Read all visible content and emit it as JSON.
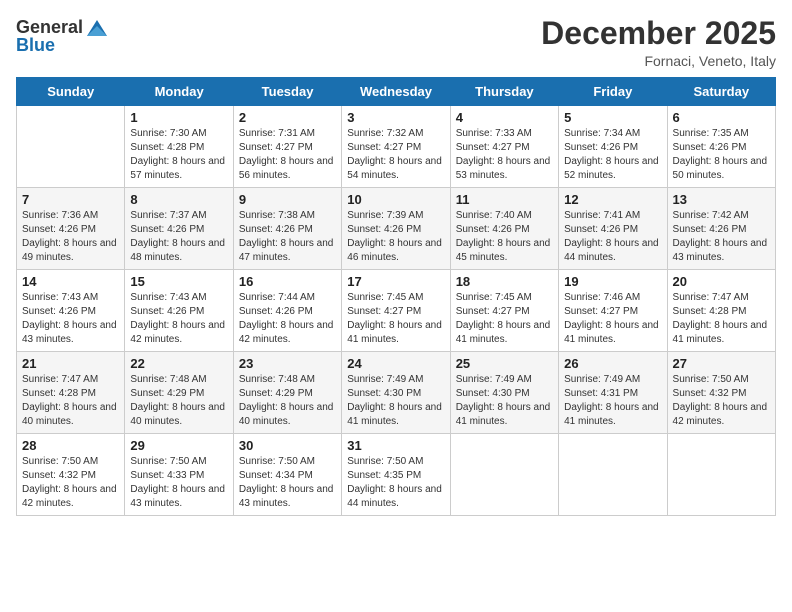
{
  "header": {
    "logo_general": "General",
    "logo_blue": "Blue",
    "month_title": "December 2025",
    "location": "Fornaci, Veneto, Italy"
  },
  "days_of_week": [
    "Sunday",
    "Monday",
    "Tuesday",
    "Wednesday",
    "Thursday",
    "Friday",
    "Saturday"
  ],
  "weeks": [
    [
      {
        "day": "",
        "sunrise": "",
        "sunset": "",
        "daylight": ""
      },
      {
        "day": "1",
        "sunrise": "Sunrise: 7:30 AM",
        "sunset": "Sunset: 4:28 PM",
        "daylight": "Daylight: 8 hours and 57 minutes."
      },
      {
        "day": "2",
        "sunrise": "Sunrise: 7:31 AM",
        "sunset": "Sunset: 4:27 PM",
        "daylight": "Daylight: 8 hours and 56 minutes."
      },
      {
        "day": "3",
        "sunrise": "Sunrise: 7:32 AM",
        "sunset": "Sunset: 4:27 PM",
        "daylight": "Daylight: 8 hours and 54 minutes."
      },
      {
        "day": "4",
        "sunrise": "Sunrise: 7:33 AM",
        "sunset": "Sunset: 4:27 PM",
        "daylight": "Daylight: 8 hours and 53 minutes."
      },
      {
        "day": "5",
        "sunrise": "Sunrise: 7:34 AM",
        "sunset": "Sunset: 4:26 PM",
        "daylight": "Daylight: 8 hours and 52 minutes."
      },
      {
        "day": "6",
        "sunrise": "Sunrise: 7:35 AM",
        "sunset": "Sunset: 4:26 PM",
        "daylight": "Daylight: 8 hours and 50 minutes."
      }
    ],
    [
      {
        "day": "7",
        "sunrise": "Sunrise: 7:36 AM",
        "sunset": "Sunset: 4:26 PM",
        "daylight": "Daylight: 8 hours and 49 minutes."
      },
      {
        "day": "8",
        "sunrise": "Sunrise: 7:37 AM",
        "sunset": "Sunset: 4:26 PM",
        "daylight": "Daylight: 8 hours and 48 minutes."
      },
      {
        "day": "9",
        "sunrise": "Sunrise: 7:38 AM",
        "sunset": "Sunset: 4:26 PM",
        "daylight": "Daylight: 8 hours and 47 minutes."
      },
      {
        "day": "10",
        "sunrise": "Sunrise: 7:39 AM",
        "sunset": "Sunset: 4:26 PM",
        "daylight": "Daylight: 8 hours and 46 minutes."
      },
      {
        "day": "11",
        "sunrise": "Sunrise: 7:40 AM",
        "sunset": "Sunset: 4:26 PM",
        "daylight": "Daylight: 8 hours and 45 minutes."
      },
      {
        "day": "12",
        "sunrise": "Sunrise: 7:41 AM",
        "sunset": "Sunset: 4:26 PM",
        "daylight": "Daylight: 8 hours and 44 minutes."
      },
      {
        "day": "13",
        "sunrise": "Sunrise: 7:42 AM",
        "sunset": "Sunset: 4:26 PM",
        "daylight": "Daylight: 8 hours and 43 minutes."
      }
    ],
    [
      {
        "day": "14",
        "sunrise": "Sunrise: 7:43 AM",
        "sunset": "Sunset: 4:26 PM",
        "daylight": "Daylight: 8 hours and 43 minutes."
      },
      {
        "day": "15",
        "sunrise": "Sunrise: 7:43 AM",
        "sunset": "Sunset: 4:26 PM",
        "daylight": "Daylight: 8 hours and 42 minutes."
      },
      {
        "day": "16",
        "sunrise": "Sunrise: 7:44 AM",
        "sunset": "Sunset: 4:26 PM",
        "daylight": "Daylight: 8 hours and 42 minutes."
      },
      {
        "day": "17",
        "sunrise": "Sunrise: 7:45 AM",
        "sunset": "Sunset: 4:27 PM",
        "daylight": "Daylight: 8 hours and 41 minutes."
      },
      {
        "day": "18",
        "sunrise": "Sunrise: 7:45 AM",
        "sunset": "Sunset: 4:27 PM",
        "daylight": "Daylight: 8 hours and 41 minutes."
      },
      {
        "day": "19",
        "sunrise": "Sunrise: 7:46 AM",
        "sunset": "Sunset: 4:27 PM",
        "daylight": "Daylight: 8 hours and 41 minutes."
      },
      {
        "day": "20",
        "sunrise": "Sunrise: 7:47 AM",
        "sunset": "Sunset: 4:28 PM",
        "daylight": "Daylight: 8 hours and 41 minutes."
      }
    ],
    [
      {
        "day": "21",
        "sunrise": "Sunrise: 7:47 AM",
        "sunset": "Sunset: 4:28 PM",
        "daylight": "Daylight: 8 hours and 40 minutes."
      },
      {
        "day": "22",
        "sunrise": "Sunrise: 7:48 AM",
        "sunset": "Sunset: 4:29 PM",
        "daylight": "Daylight: 8 hours and 40 minutes."
      },
      {
        "day": "23",
        "sunrise": "Sunrise: 7:48 AM",
        "sunset": "Sunset: 4:29 PM",
        "daylight": "Daylight: 8 hours and 40 minutes."
      },
      {
        "day": "24",
        "sunrise": "Sunrise: 7:49 AM",
        "sunset": "Sunset: 4:30 PM",
        "daylight": "Daylight: 8 hours and 41 minutes."
      },
      {
        "day": "25",
        "sunrise": "Sunrise: 7:49 AM",
        "sunset": "Sunset: 4:30 PM",
        "daylight": "Daylight: 8 hours and 41 minutes."
      },
      {
        "day": "26",
        "sunrise": "Sunrise: 7:49 AM",
        "sunset": "Sunset: 4:31 PM",
        "daylight": "Daylight: 8 hours and 41 minutes."
      },
      {
        "day": "27",
        "sunrise": "Sunrise: 7:50 AM",
        "sunset": "Sunset: 4:32 PM",
        "daylight": "Daylight: 8 hours and 42 minutes."
      }
    ],
    [
      {
        "day": "28",
        "sunrise": "Sunrise: 7:50 AM",
        "sunset": "Sunset: 4:32 PM",
        "daylight": "Daylight: 8 hours and 42 minutes."
      },
      {
        "day": "29",
        "sunrise": "Sunrise: 7:50 AM",
        "sunset": "Sunset: 4:33 PM",
        "daylight": "Daylight: 8 hours and 43 minutes."
      },
      {
        "day": "30",
        "sunrise": "Sunrise: 7:50 AM",
        "sunset": "Sunset: 4:34 PM",
        "daylight": "Daylight: 8 hours and 43 minutes."
      },
      {
        "day": "31",
        "sunrise": "Sunrise: 7:50 AM",
        "sunset": "Sunset: 4:35 PM",
        "daylight": "Daylight: 8 hours and 44 minutes."
      },
      {
        "day": "",
        "sunrise": "",
        "sunset": "",
        "daylight": ""
      },
      {
        "day": "",
        "sunrise": "",
        "sunset": "",
        "daylight": ""
      },
      {
        "day": "",
        "sunrise": "",
        "sunset": "",
        "daylight": ""
      }
    ]
  ]
}
